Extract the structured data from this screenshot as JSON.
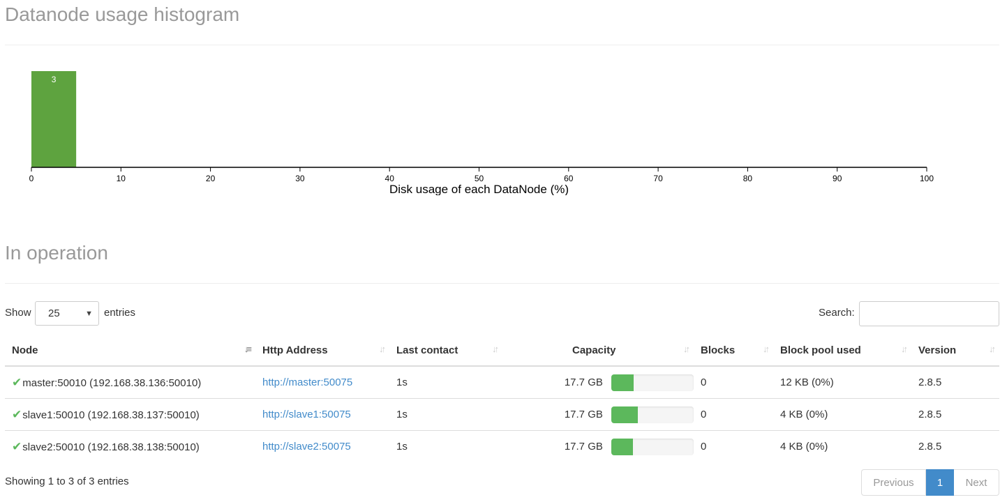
{
  "histogram": {
    "heading": "Datanode usage histogram"
  },
  "chart_data": {
    "type": "bar",
    "xlabel": "Disk usage of each DataNode (%)",
    "xlim": [
      0,
      100
    ],
    "ticks": [
      0,
      10,
      20,
      30,
      40,
      50,
      60,
      70,
      80,
      90,
      100
    ],
    "bins": [
      {
        "from": 0,
        "to": 5,
        "count": 3
      }
    ],
    "bar_color": "#5ea33f"
  },
  "operation": {
    "heading": "In operation"
  },
  "controls": {
    "show_label": "Show",
    "page_size": "25",
    "entries_label": "entries",
    "search_label": "Search:"
  },
  "table": {
    "columns": [
      "Node",
      "Http Address",
      "Last contact",
      "Capacity",
      "Blocks",
      "Block pool used",
      "Version"
    ],
    "rows": [
      {
        "node": "master:50010 (192.168.38.136:50010)",
        "http": "http://master:50075",
        "last_contact": "1s",
        "capacity": "17.7 GB",
        "usage_fraction": 0.27,
        "blocks": "0",
        "block_pool_used": "12 KB (0%)",
        "version": "2.8.5"
      },
      {
        "node": "slave1:50010 (192.168.38.137:50010)",
        "http": "http://slave1:50075",
        "last_contact": "1s",
        "capacity": "17.7 GB",
        "usage_fraction": 0.32,
        "blocks": "0",
        "block_pool_used": "4 KB (0%)",
        "version": "2.8.5"
      },
      {
        "node": "slave2:50010 (192.168.38.138:50010)",
        "http": "http://slave2:50075",
        "last_contact": "1s",
        "capacity": "17.7 GB",
        "usage_fraction": 0.26,
        "blocks": "0",
        "block_pool_used": "4 KB (0%)",
        "version": "2.8.5"
      }
    ]
  },
  "footer": {
    "info": "Showing 1 to 3 of 3 entries",
    "prev": "Previous",
    "current": "1",
    "next": "Next"
  },
  "colors": {
    "ok": "#5cb85c",
    "link": "#428bca"
  },
  "icons": {
    "status": "check-icon",
    "sort": "sort-icon"
  }
}
